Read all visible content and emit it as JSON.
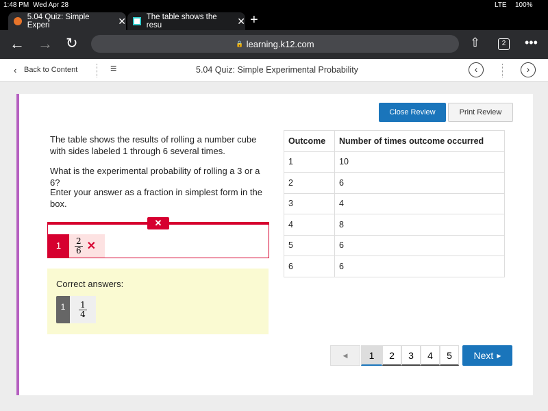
{
  "status": {
    "time": "1:48 PM",
    "date": "Wed Apr 28",
    "carrier": "LTE",
    "battery": "100%"
  },
  "tabs": [
    {
      "title": "5.04 Quiz: Simple Experi"
    },
    {
      "title": "The table shows the resu"
    }
  ],
  "url": "learning.k12.com",
  "tab_count": "2",
  "nav": {
    "back": "Back to Content",
    "title": "5.04 Quiz: Simple Experimental Probability"
  },
  "buttons": {
    "close_review": "Close Review",
    "print_review": "Print Review"
  },
  "question": {
    "p1": "The table shows the results of rolling a number cube with sides labeled 1 through 6 several times.",
    "p2": "What is the experimental probability of rolling a 3 or a 6?",
    "p3": "Enter your answer as a fraction in simplest form in the box."
  },
  "answer": {
    "index": "1",
    "num": "2",
    "den": "6",
    "status": "incorrect"
  },
  "correct": {
    "label": "Correct answers:",
    "index": "1",
    "num": "1",
    "den": "4"
  },
  "table": {
    "headers": [
      "Outcome",
      "Number of times outcome occurred"
    ],
    "rows": [
      [
        "1",
        "10"
      ],
      [
        "2",
        "6"
      ],
      [
        "3",
        "4"
      ],
      [
        "4",
        "8"
      ],
      [
        "5",
        "6"
      ],
      [
        "6",
        "6"
      ]
    ]
  },
  "pagination": {
    "pages": [
      "1",
      "2",
      "3",
      "4",
      "5"
    ],
    "current": "1",
    "next": "Next"
  },
  "colors": {
    "accent": "#1a75bb",
    "error": "#d6002f",
    "sidebar": "#b55fc0"
  }
}
